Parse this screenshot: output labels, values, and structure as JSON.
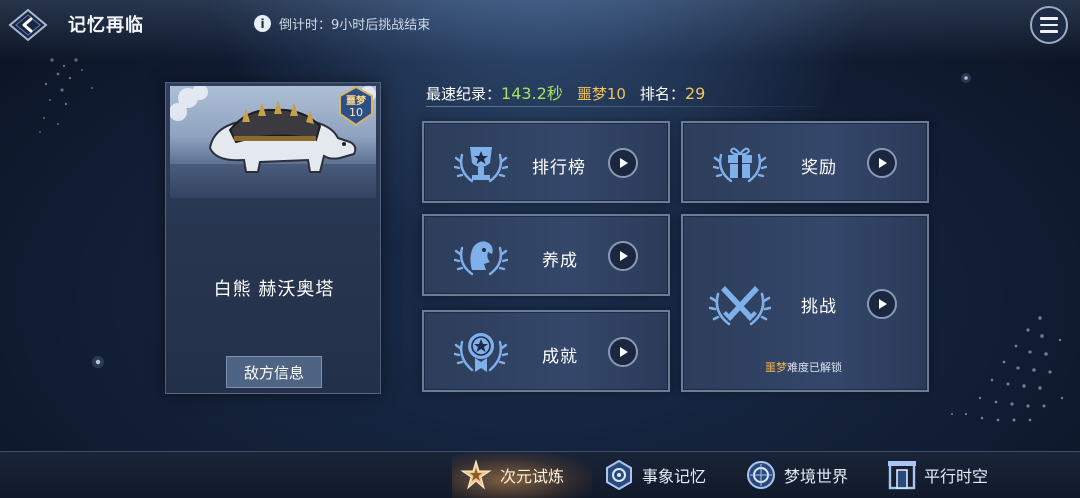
{
  "header": {
    "title": "记忆再临",
    "timer_text": "倒计时：9小时后挑战结束"
  },
  "enemy": {
    "difficulty_label": "噩梦",
    "difficulty_level": "10",
    "name": "白熊 赫沃奥塔",
    "info_button": "敌方信息"
  },
  "stats": {
    "fastest_label": "最速纪录：",
    "fastest_value": "143.2秒",
    "difficulty": "噩梦10",
    "rank_label": "排名：",
    "rank_value": "29"
  },
  "panels": {
    "leaderboard": "排行榜",
    "rewards": "奖励",
    "cultivate": "养成",
    "challenge": "挑战",
    "achievements": "成就",
    "unlock_highlight": "噩梦",
    "unlock_text": "难度已解锁"
  },
  "bottom_nav": [
    {
      "label": "次元试炼",
      "icon": "star-trial-icon",
      "active": true
    },
    {
      "label": "事象记忆",
      "icon": "hex-emblem-icon",
      "active": false
    },
    {
      "label": "梦境世界",
      "icon": "dream-orb-icon",
      "active": false
    },
    {
      "label": "平行时空",
      "icon": "gate-icon",
      "active": false
    }
  ],
  "colors": {
    "record_green": "#a6e35c",
    "gold": "#f2c35c",
    "panel_border": "#6b7c98",
    "icon_blue": "#7fb0ea"
  }
}
